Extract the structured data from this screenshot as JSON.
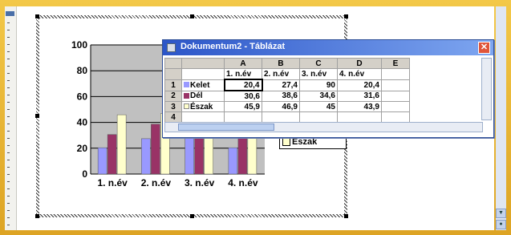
{
  "datasheet": {
    "title": "Dokumentum2 - Táblázat",
    "close_glyph": "✕",
    "col_headers": [
      "A",
      "B",
      "C",
      "D",
      "E"
    ],
    "header_row": [
      "1. n.év",
      "2. n.év",
      "3. n.év",
      "4. n.év"
    ],
    "rows": [
      {
        "num": "1",
        "label": "Kelet",
        "values": [
          "20,4",
          "27,4",
          "90",
          "20,4"
        ]
      },
      {
        "num": "2",
        "label": "Dél",
        "values": [
          "30,6",
          "38,6",
          "34,6",
          "31,6"
        ]
      },
      {
        "num": "3",
        "label": "Észak",
        "values": [
          "45,9",
          "46,9",
          "45",
          "43,9"
        ]
      },
      {
        "num": "4",
        "label": "",
        "values": [
          "",
          "",
          "",
          ""
        ]
      }
    ]
  },
  "chart": {
    "legend_partial": "Észak"
  },
  "chart_data": {
    "type": "bar",
    "categories": [
      "1. n.év",
      "2. n.év",
      "3. n.év",
      "4. n.év"
    ],
    "ylim": [
      0,
      100
    ],
    "yticks": [
      "0",
      "20",
      "40",
      "60",
      "80",
      "100"
    ],
    "series": [
      {
        "name": "Kelet",
        "color": "#9999ff",
        "values": [
          20.4,
          27.4,
          90,
          20.4
        ]
      },
      {
        "name": "Dél",
        "color": "#993366",
        "values": [
          30.6,
          38.6,
          34.6,
          31.6
        ]
      },
      {
        "name": "Észak",
        "color": "#ffffcc",
        "values": [
          45.9,
          46.9,
          45,
          43.9
        ]
      }
    ]
  }
}
